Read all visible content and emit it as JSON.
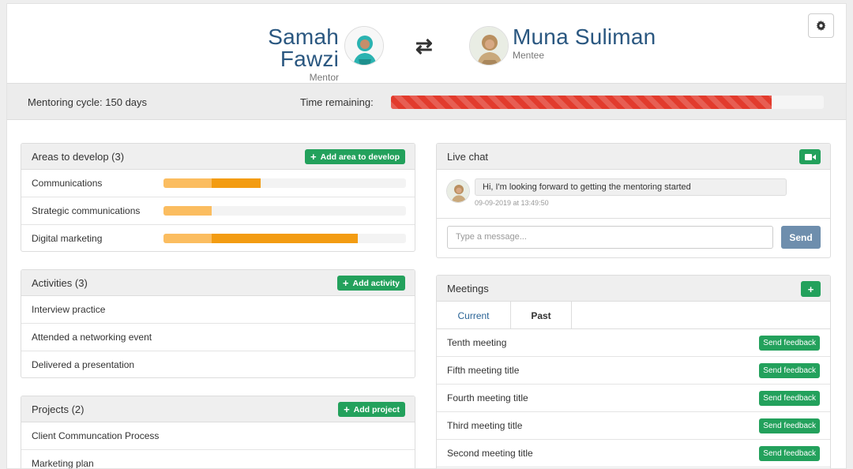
{
  "header": {
    "mentor": {
      "name": "Samah Fawzi",
      "role": "Mentor"
    },
    "mentee": {
      "name": "Muna Suliman",
      "role": "Mentee"
    },
    "swap_icon": "swap-arrows-icon",
    "settings_icon": "gear-icon"
  },
  "cycle": {
    "label": "Mentoring cycle: 150 days",
    "time_label": "Time remaining:",
    "time_remaining_fraction": 0.88,
    "bar_color": "#e23b2d"
  },
  "areas": {
    "title": "Areas to develop (3)",
    "add_label": "Add area to develop",
    "items": [
      {
        "label": "Communications",
        "light": 0.2,
        "dark": 0.2
      },
      {
        "label": "Strategic communications",
        "light": 0.2,
        "dark": 0.0
      },
      {
        "label": "Digital marketing",
        "light": 0.2,
        "dark": 0.6
      }
    ],
    "colors": {
      "light": "#fbbd60",
      "dark": "#f39c12"
    }
  },
  "activities": {
    "title": "Activities (3)",
    "add_label": "Add activity",
    "items": [
      "Interview practice",
      "Attended a networking event",
      "Delivered a presentation"
    ]
  },
  "projects": {
    "title": "Projects (2)",
    "add_label": "Add project",
    "items": [
      "Client Communcation Process",
      "Marketing plan"
    ]
  },
  "chat": {
    "title": "Live chat",
    "video_icon": "video-camera-icon",
    "message": "Hi, I'm looking forward to getting the mentoring started",
    "timestamp": "09-09-2019 at 13:49:50",
    "input_placeholder": "Type a message...",
    "send_label": "Send"
  },
  "meetings": {
    "title": "Meetings",
    "add_icon": "plus-icon",
    "tabs": [
      "Current",
      "Past"
    ],
    "feedback_label": "Send feedback",
    "items": [
      "Tenth meeting",
      "Fifth meeting title",
      "Fourth meeting title",
      "Third meeting title",
      "Second meeting title"
    ]
  },
  "accent_color": "#23a15c",
  "name_color": "#2a5780"
}
